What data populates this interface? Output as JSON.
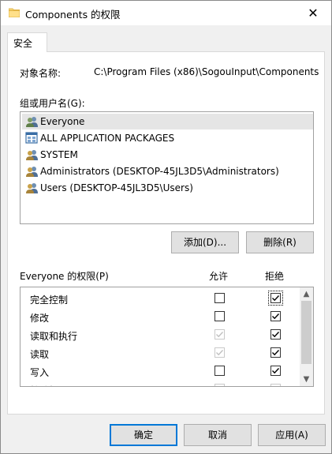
{
  "window": {
    "title": "Components 的权限",
    "close_glyph": "✕",
    "folder_icon": "folder-icon"
  },
  "tabs": [
    {
      "label": "安全"
    }
  ],
  "object": {
    "label": "对象名称:",
    "value": "C:\\Program Files (x86)\\SogouInput\\Components"
  },
  "groups": {
    "label": "组或用户名(G):",
    "items": [
      {
        "name": "Everyone",
        "icon": "users-icon",
        "selected": true
      },
      {
        "name": "ALL APPLICATION PACKAGES",
        "icon": "app-packages-icon",
        "selected": false
      },
      {
        "name": "SYSTEM",
        "icon": "users-icon",
        "selected": false
      },
      {
        "name": "Administrators (DESKTOP-45JL3D5\\Administrators)",
        "icon": "users-icon",
        "selected": false
      },
      {
        "name": "Users (DESKTOP-45JL3D5\\Users)",
        "icon": "users-icon",
        "selected": false
      }
    ],
    "add_button": "添加(D)...",
    "remove_button": "删除(R)"
  },
  "permissions": {
    "label": "Everyone 的权限(P)",
    "allow_header": "允许",
    "deny_header": "拒绝",
    "rows": [
      {
        "name": "完全控制",
        "allow": false,
        "allow_disabled": false,
        "deny": true,
        "deny_disabled": false
      },
      {
        "name": "修改",
        "allow": false,
        "allow_disabled": false,
        "deny": true,
        "deny_disabled": false
      },
      {
        "name": "读取和执行",
        "allow": true,
        "allow_disabled": true,
        "deny": true,
        "deny_disabled": false
      },
      {
        "name": "读取",
        "allow": true,
        "allow_disabled": true,
        "deny": true,
        "deny_disabled": false
      },
      {
        "name": "写入",
        "allow": false,
        "allow_disabled": false,
        "deny": true,
        "deny_disabled": false
      },
      {
        "name": "特殊权限",
        "allow": false,
        "allow_disabled": true,
        "deny": false,
        "deny_disabled": true
      }
    ]
  },
  "footer": {
    "ok": "确定",
    "cancel": "取消",
    "apply": "应用(A)"
  },
  "colors": {
    "accent": "#0078d7",
    "selection": "#e5e5e5",
    "button_face": "#e1e1e1"
  }
}
